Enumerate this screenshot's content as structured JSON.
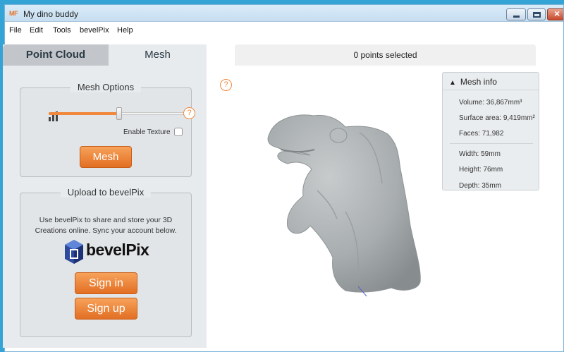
{
  "window": {
    "app_icon": "MF",
    "title": "My dino buddy"
  },
  "menu": [
    "File",
    "Edit",
    "Tools",
    "bevelPix",
    "Help"
  ],
  "tabs": {
    "point_cloud": "Point Cloud",
    "mesh": "Mesh"
  },
  "status": {
    "selection": "0 points selected"
  },
  "mesh_options": {
    "title": "Mesh Options",
    "slider_value": 0.5,
    "help": "?",
    "enable_texture_label": "Enable Texture",
    "enable_texture_checked": false,
    "mesh_button": "Mesh"
  },
  "upload": {
    "title": "Upload to bevelPix",
    "line1": "Use bevelPix to share and store your 3D",
    "line2": "Creations online. Sync your account below.",
    "brand": "bevelPix",
    "sign_in": "Sign in",
    "sign_up": "Sign up"
  },
  "viewport": {
    "help": "?"
  },
  "mesh_info": {
    "title": "Mesh info",
    "volume": "Volume: 36,867mm³",
    "surface_area": "Surface area: 9,419mm²",
    "faces": "Faces: 71,982",
    "width": "Width: 59mm",
    "height": "Height: 76mm",
    "depth": "Depth: 35mm"
  },
  "colors": {
    "accent": "#f0883e",
    "desktop": "#34a3d6",
    "model": "#a8adaf"
  }
}
